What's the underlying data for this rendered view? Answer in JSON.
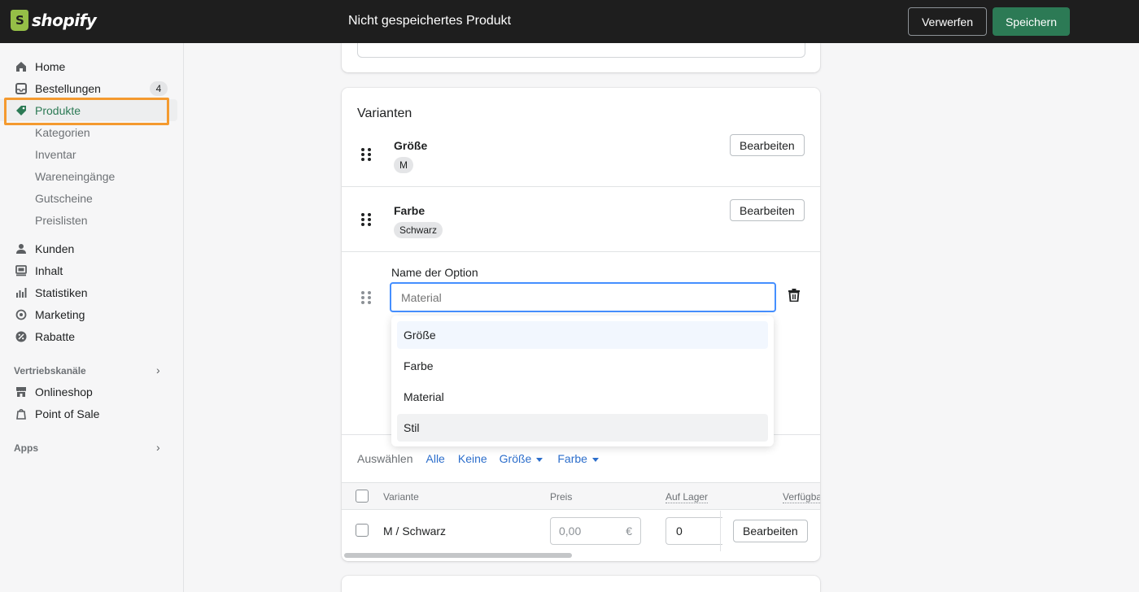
{
  "topbar": {
    "logo_text": "shopify",
    "title": "Nicht gespeichertes Produkt",
    "discard_label": "Verwerfen",
    "save_label": "Speichern"
  },
  "sidebar": {
    "items": [
      {
        "label": "Home",
        "icon": "home-icon"
      },
      {
        "label": "Bestellungen",
        "icon": "inbox-icon",
        "badge": "4"
      },
      {
        "label": "Produkte",
        "icon": "tag-icon",
        "active": true
      },
      {
        "label": "Kategorien"
      },
      {
        "label": "Inventar"
      },
      {
        "label": "Wareneingänge"
      },
      {
        "label": "Gutscheine"
      },
      {
        "label": "Preislisten"
      },
      {
        "label": "Kunden",
        "icon": "person-icon"
      },
      {
        "label": "Inhalt",
        "icon": "content-icon"
      },
      {
        "label": "Statistiken",
        "icon": "bar-chart-icon"
      },
      {
        "label": "Marketing",
        "icon": "target-icon"
      },
      {
        "label": "Rabatte",
        "icon": "discount-icon"
      }
    ],
    "sales_channels_title": "Vertriebskanäle",
    "channels": [
      {
        "label": "Onlineshop",
        "icon": "store-icon"
      },
      {
        "label": "Point of Sale",
        "icon": "pos-icon"
      }
    ],
    "apps_title": "Apps"
  },
  "variants": {
    "title": "Varianten",
    "options": [
      {
        "name": "Größe",
        "value": "M",
        "edit_label": "Bearbeiten"
      },
      {
        "name": "Farbe",
        "value": "Schwarz",
        "edit_label": "Bearbeiten"
      }
    ],
    "new_option": {
      "label": "Name der Option",
      "placeholder": "Material",
      "suggestions": [
        "Größe",
        "Farbe",
        "Material",
        "Stil"
      ]
    },
    "select": {
      "label": "Auswählen",
      "all": "Alle",
      "none": "Keine",
      "size": "Größe",
      "color": "Farbe"
    },
    "table": {
      "headers": [
        "Variante",
        "Preis",
        "Auf Lager",
        "Verfügba"
      ],
      "rows": [
        {
          "variant": "M / Schwarz",
          "price_placeholder": "0,00",
          "currency": "€",
          "stock": "0",
          "edit_label": "Bearbeiten"
        }
      ]
    }
  }
}
